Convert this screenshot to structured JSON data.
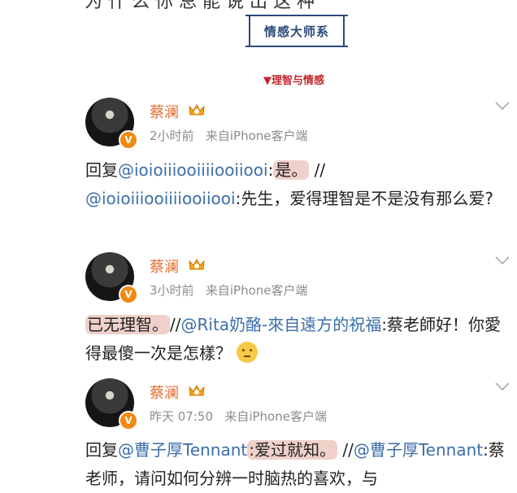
{
  "top_partial_text": "为 什 么 你 总 能 说 出 这 种",
  "badge": {
    "label": "情感大师系"
  },
  "section": {
    "label": "▼理智与情感"
  },
  "posts": [
    {
      "author": "蔡澜",
      "time": "2小时前",
      "source": "来自iPhone客户端",
      "reply_prefix": "回复",
      "mention1": "@ioioiiiooiiiiooiiooi",
      "sep1": ":",
      "highlight": "是。",
      "slashes": " //",
      "mention2": "@ioioiiiooiiiiooiiooi",
      "tail": ":先生，爱得理智是不是没有那么爱?"
    },
    {
      "author": "蔡澜",
      "time": "3小时前",
      "source": "来自iPhone客户端",
      "highlight": "已无理智。",
      "slashes": "//",
      "mention": "@Rita奶酪-來自遠方的祝福",
      "tail": ":蔡老師好！你愛得最傻一次是怎樣？"
    },
    {
      "author": "蔡澜",
      "time": "昨天 07:50",
      "source": "来自iPhone客户端",
      "reply_prefix": "回复",
      "mention1": "@曹子厚Tennant",
      "highlight": ":爱过就知。",
      "slashes": "//",
      "mention2": "@曹子厚Tennant",
      "tail": ":蔡老师，请问如何分辨一时脑热的喜欢，与"
    }
  ],
  "icons": {
    "verified": "verified-v-icon",
    "crown": "vip-crown-icon",
    "chevron": "chevron-down-icon",
    "emoji": "thinking-emoji-icon"
  },
  "colors": {
    "name": "#e36a2c",
    "link": "#3b6ea8",
    "highlight": "#f0d1ca",
    "section": "#c0272d",
    "badge": "#2c4a7a"
  }
}
